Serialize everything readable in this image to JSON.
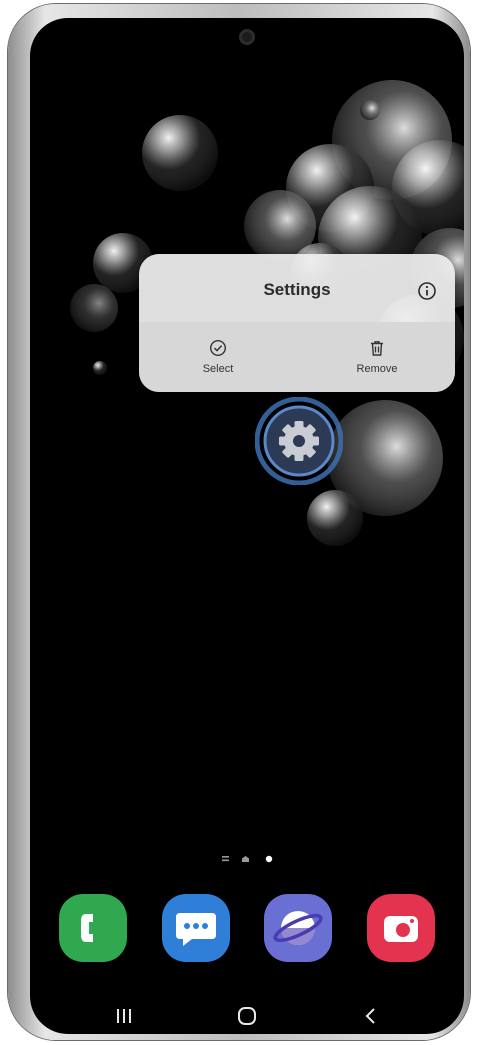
{
  "popup": {
    "title": "Settings",
    "actions": [
      {
        "label": "Select",
        "icon": "check-circle-icon"
      },
      {
        "label": "Remove",
        "icon": "trash-icon"
      }
    ],
    "info_icon": "info-icon"
  },
  "home": {
    "focused_app": "settings-gear-icon",
    "page_indicator": {
      "pages": 3,
      "current": 3
    }
  },
  "dock": [
    {
      "name": "phone",
      "icon": "phone-icon",
      "color": "#2fa84f"
    },
    {
      "name": "messages",
      "icon": "chat-bubble-icon",
      "color": "#2f7fd8"
    },
    {
      "name": "internet",
      "icon": "globe-icon",
      "color": "#6a6fd3"
    },
    {
      "name": "camera",
      "icon": "camera-icon",
      "color": "#e3334f"
    }
  ],
  "navbar": [
    {
      "name": "recents",
      "icon": "recents-icon"
    },
    {
      "name": "home",
      "icon": "home-icon"
    },
    {
      "name": "back",
      "icon": "back-icon"
    }
  ]
}
